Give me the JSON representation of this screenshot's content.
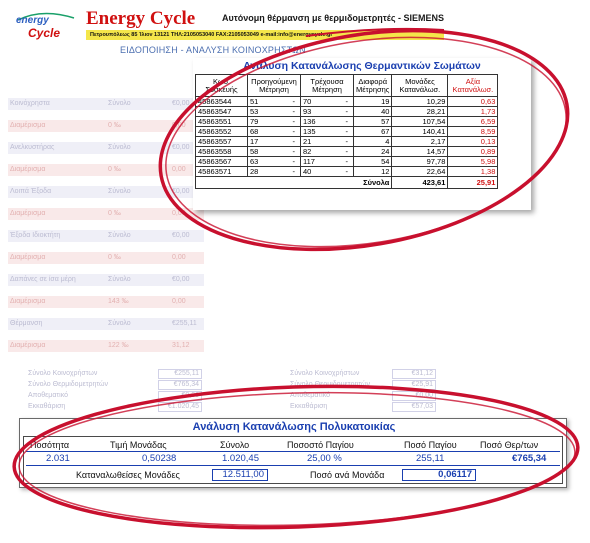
{
  "header": {
    "logo_text_top": "energy",
    "logo_text_bottom": "Cycle",
    "brand": "Energy Cycle",
    "tagline": "Αυτόνομη θέρμανση με θερμιδομετρητές - SIEMENS",
    "address": "Πετρουπόλεως 85 Ίλιον 13121 ΤΗΛ:2105053040 FAX:2105053049 e-mail:info@energycycle.gr",
    "subtitle": "ΕΙΔΟΠΟΙΗΣΗ - ΑΝΑΛΥΣΗ ΚΟΙΝΟΧΡΗΣΤΩΝ"
  },
  "consumption": {
    "title": "Ανάλυση Κατανάλωσης Θερμαντικών Σωμάτων",
    "headers": [
      "Κωδ. Συσκευής",
      "Προηγούμενη Μέτρηση",
      "Τρέχουσα Μέτρηση",
      "Διαφορά Μέτρησης",
      "Μονάδες Κατανάλωσ.",
      "Αξία Κατανάλωσ."
    ],
    "rows": [
      {
        "code": "45863544",
        "prev": "51",
        "curr": "70",
        "diff": "19",
        "units": "10,29",
        "value": "0,63"
      },
      {
        "code": "45863547",
        "prev": "53",
        "curr": "93",
        "diff": "40",
        "units": "28,21",
        "value": "1,73"
      },
      {
        "code": "45863551",
        "prev": "79",
        "curr": "136",
        "diff": "57",
        "units": "107,54",
        "value": "6,59"
      },
      {
        "code": "45863552",
        "prev": "68",
        "curr": "135",
        "diff": "67",
        "units": "140,41",
        "value": "8,59"
      },
      {
        "code": "45863557",
        "prev": "17",
        "curr": "21",
        "diff": "4",
        "units": "2,17",
        "value": "0,13"
      },
      {
        "code": "45863558",
        "prev": "58",
        "curr": "82",
        "diff": "24",
        "units": "14,57",
        "value": "0,89"
      },
      {
        "code": "45863567",
        "prev": "63",
        "curr": "117",
        "diff": "54",
        "units": "97,78",
        "value": "5,98"
      },
      {
        "code": "45863571",
        "prev": "28",
        "curr": "40",
        "diff": "12",
        "units": "22,64",
        "value": "1,38"
      }
    ],
    "total_label": "Σύνολα",
    "total_units": "423,61",
    "total_value": "25,91"
  },
  "building": {
    "title": "Ανάλυση Κατανάλωσης Πολυκατοικίας",
    "headers": [
      "Ποσότητα",
      "Τιμή Μονάδας",
      "Σύνολο",
      "Ποσοστό Παγίου",
      "Ποσό Παγίου",
      "Ποσό Θερ/των"
    ],
    "values": [
      "2.031",
      "0,50238",
      "1.020,45",
      "25,00 %",
      "255,11",
      "€765,34"
    ],
    "units_label": "Καταναλωθείσες Μονάδες",
    "units_value": "12.511,00",
    "per_unit_label": "Ποσό ανά Μονάδα",
    "per_unit_value": "0,06117"
  },
  "background_doc": {
    "rows": [
      {
        "label": "Κοινόχρηστα",
        "mid": "Σύνολο",
        "val": "€0,00"
      },
      {
        "label": "Διαμέρισμα",
        "mid": "0 ‰",
        "val": "0,00"
      },
      {
        "label": "Ανελκυστήρας",
        "mid": "Σύνολο",
        "val": "€0,00"
      },
      {
        "label": "Διαμέρισμα",
        "mid": "0 ‰",
        "val": "0,00"
      },
      {
        "label": "Λοιπά Έξοδα",
        "mid": "Σύνολο",
        "val": "€0,00"
      },
      {
        "label": "Διαμέρισμα",
        "mid": "0 ‰",
        "val": "0,00"
      },
      {
        "label": "Έξοδα Ιδιοκτήτη",
        "mid": "Σύνολο",
        "val": "€0,00"
      },
      {
        "label": "Διαμέρισμα",
        "mid": "0 ‰",
        "val": "0,00"
      },
      {
        "label": "Δαπάνες σε ίσα μέρη",
        "mid": "Σύνολο",
        "val": "€0,00"
      },
      {
        "label": "Διαμέρισμα",
        "mid": "143 ‰",
        "val": "0,00"
      },
      {
        "label": "Θέρμανση",
        "mid": "Σύνολο",
        "val": "€255,11"
      },
      {
        "label": "Διαμέρισμα",
        "mid": "122 ‰",
        "val": "31,12"
      }
    ],
    "bottom_left": [
      {
        "label": "Σύνολο Κοινοχρήστων",
        "val": "€255,11"
      },
      {
        "label": "Σύνολο Θερμιδομετρητών",
        "val": "€765,34"
      },
      {
        "label": "Αποθεματικό",
        "val": "€0,00"
      },
      {
        "label": "Εκκαθάριση",
        "val": "€1.020,45"
      }
    ],
    "bottom_right": [
      {
        "label": "Σύνολο Κοινοχρήστων",
        "val": "€31,12"
      },
      {
        "label": "Σύνολο Θερμιδομετρητών",
        "val": "€25,91"
      },
      {
        "label": "Αποθεματικό",
        "val": "€0,00"
      },
      {
        "label": "Εκκαθάριση",
        "val": "€57,03"
      }
    ]
  },
  "colors": {
    "brand_red": "#d01010",
    "title_blue": "#1a3fb0",
    "annotation_red": "#c8102e",
    "address_yellow": "#f4e64a"
  }
}
